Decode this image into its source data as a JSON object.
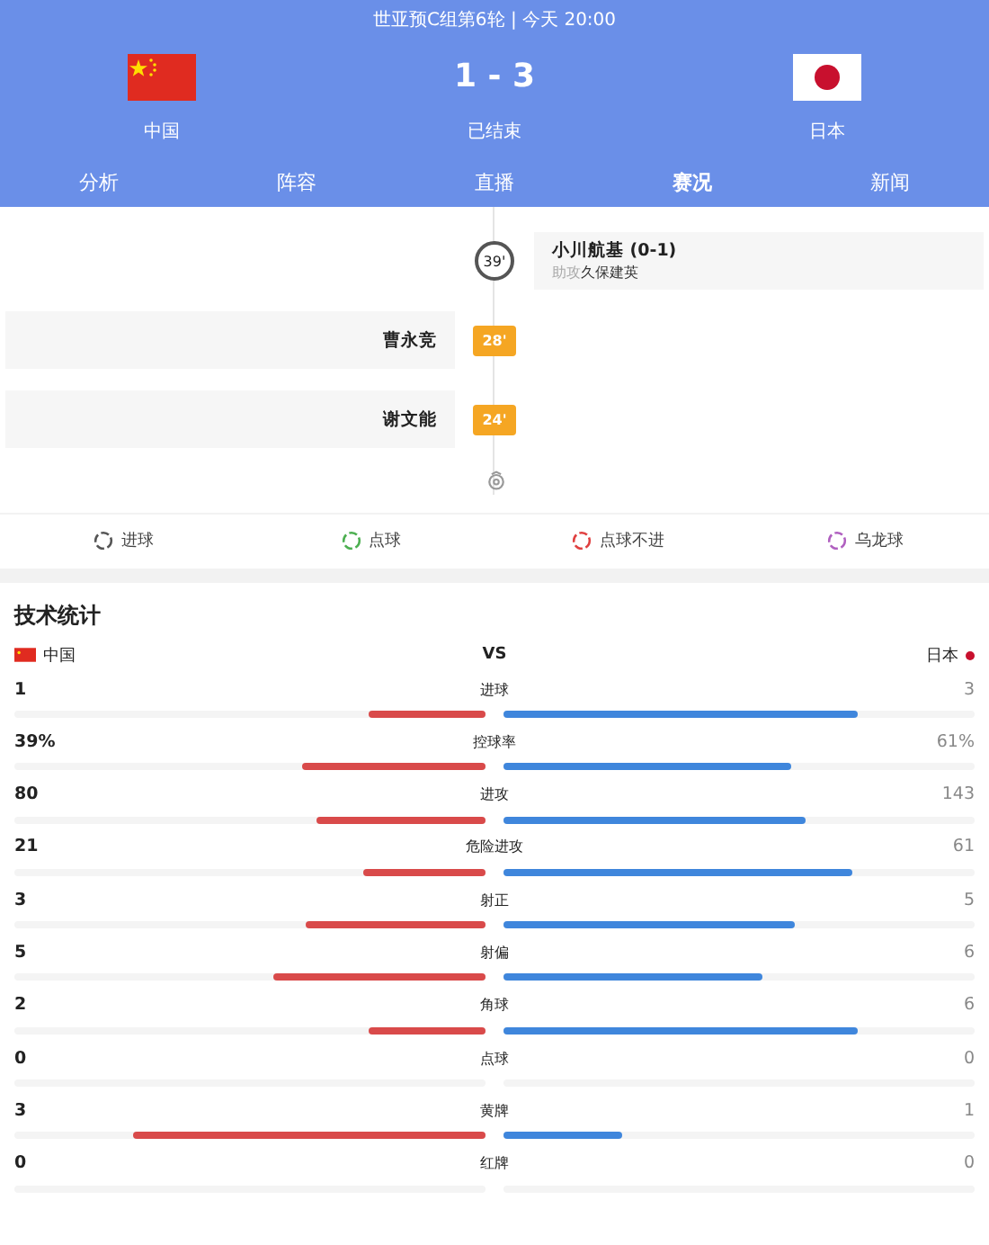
{
  "header": {
    "subtitle": "世亚预C组第6轮 | 今天 20:00",
    "home": {
      "name": "中国",
      "kind": "china"
    },
    "away": {
      "name": "日本",
      "kind": "japan"
    },
    "score": "1 - 3",
    "status": "已结束"
  },
  "tabs": [
    {
      "label": "分析",
      "selected": false
    },
    {
      "label": "阵容",
      "selected": false
    },
    {
      "label": "直播",
      "selected": false
    },
    {
      "label": "赛况",
      "selected": true
    },
    {
      "label": "新闻",
      "selected": false
    }
  ],
  "timeline": [
    {
      "kind": "away_goal",
      "minute": "39'",
      "player": "小川航基 (0-1)",
      "assist_label": "助攻",
      "assist": "久保建英"
    },
    {
      "kind": "home_yellow",
      "minute": "28'",
      "player": "曹永竞"
    },
    {
      "kind": "home_yellow",
      "minute": "24'",
      "player": "谢文能"
    }
  ],
  "legend": [
    {
      "label": "进球",
      "color": "#555555"
    },
    {
      "label": "点球",
      "color": "#4caf50"
    },
    {
      "label": "点球不进",
      "color": "#e04040"
    },
    {
      "label": "乌龙球",
      "color": "#b060c0"
    }
  ],
  "stats": {
    "title": "技术统计",
    "home": "中国",
    "vs": "VS",
    "away": "日本",
    "rows": [
      {
        "name": "进球",
        "home": "1",
        "away": "3",
        "home_bar": {
          "level": 0.25
        },
        "away_bar": {
          "level": 0.75
        }
      },
      {
        "name": "控球率",
        "home": "39%",
        "away": "61%",
        "home_bar": {
          "level": 0.39
        },
        "away_bar": {
          "level": 0.61
        }
      },
      {
        "name": "进攻",
        "home": "80",
        "away": "143",
        "home_bar": {
          "level": 0.36
        },
        "away_bar": {
          "level": 0.64
        }
      },
      {
        "name": "危险进攻",
        "home": "21",
        "away": "61",
        "home_bar": {
          "level": 0.26
        },
        "away_bar": {
          "level": 0.74
        }
      },
      {
        "name": "射正",
        "home": "3",
        "away": "5",
        "home_bar": {
          "level": 0.38
        },
        "away_bar": {
          "level": 0.62
        }
      },
      {
        "name": "射偏",
        "home": "5",
        "away": "6",
        "home_bar": {
          "level": 0.45
        },
        "away_bar": {
          "level": 0.55
        }
      },
      {
        "name": "角球",
        "home": "2",
        "away": "6",
        "home_bar": {
          "level": 0.25
        },
        "away_bar": {
          "level": 0.75
        }
      },
      {
        "name": "点球",
        "home": "0",
        "away": "0"
      },
      {
        "name": "黄牌",
        "home": "3",
        "away": "1",
        "home_bar": {
          "level": 0.75
        },
        "away_bar": {
          "level": 0.25
        }
      },
      {
        "name": "红牌",
        "home": "0",
        "away": "0"
      }
    ]
  }
}
